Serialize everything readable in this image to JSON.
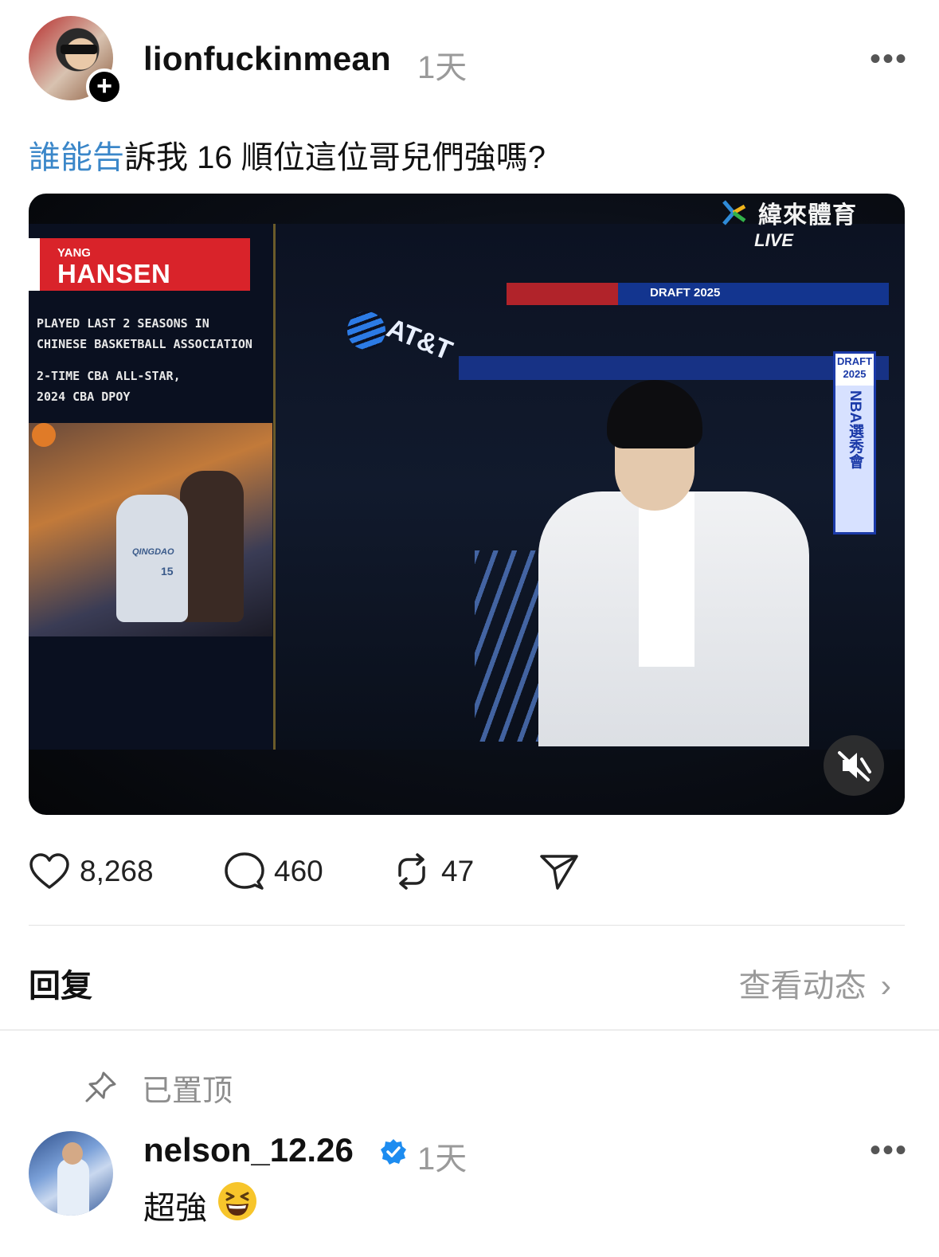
{
  "post": {
    "username": "lionfuckinmean",
    "time": "1天",
    "more_label": "•••",
    "follow_label": "+",
    "caption_mention": "誰能告",
    "caption_rest": "訴我 16 順位這位哥兒們強嗎?"
  },
  "video": {
    "player_first": "YANG",
    "player_last": "HANSEN",
    "stat_line_1": "PLAYED LAST 2 SEASONS IN",
    "stat_line_2": "CHINESE BASKETBALL ASSOCIATION",
    "stat_line_3": "2-TIME CBA ALL-STAR,",
    "stat_line_4": "2024 CBA DPOY",
    "jersey_team": "QINGDAO",
    "jersey_number": "15",
    "broadcaster": "緯來體育",
    "live": "LIVE",
    "ticker": "DRAFT 2025",
    "sponsor": "AT&T",
    "banner_top": "DRAFT 2025",
    "banner_side": "NBA選秀會",
    "muted": true,
    "mute_icon": "muted-speaker-icon"
  },
  "actions": {
    "likes": "8,268",
    "comments": "460",
    "reposts": "47",
    "icons": [
      "heart-icon",
      "comment-icon",
      "repost-icon",
      "share-icon"
    ]
  },
  "replies_header": {
    "title": "回复",
    "view_activity": "查看动态",
    "chevron": "›"
  },
  "pinned_reply": {
    "pinned_label": "已置顶",
    "username": "nelson_12.26",
    "verified": true,
    "time": "1天",
    "more_label": "•••",
    "text": "超強"
  },
  "colors": {
    "mention": "#3b87c9",
    "muted_text": "#9a9a9a",
    "verified": "#1d8cf0"
  }
}
